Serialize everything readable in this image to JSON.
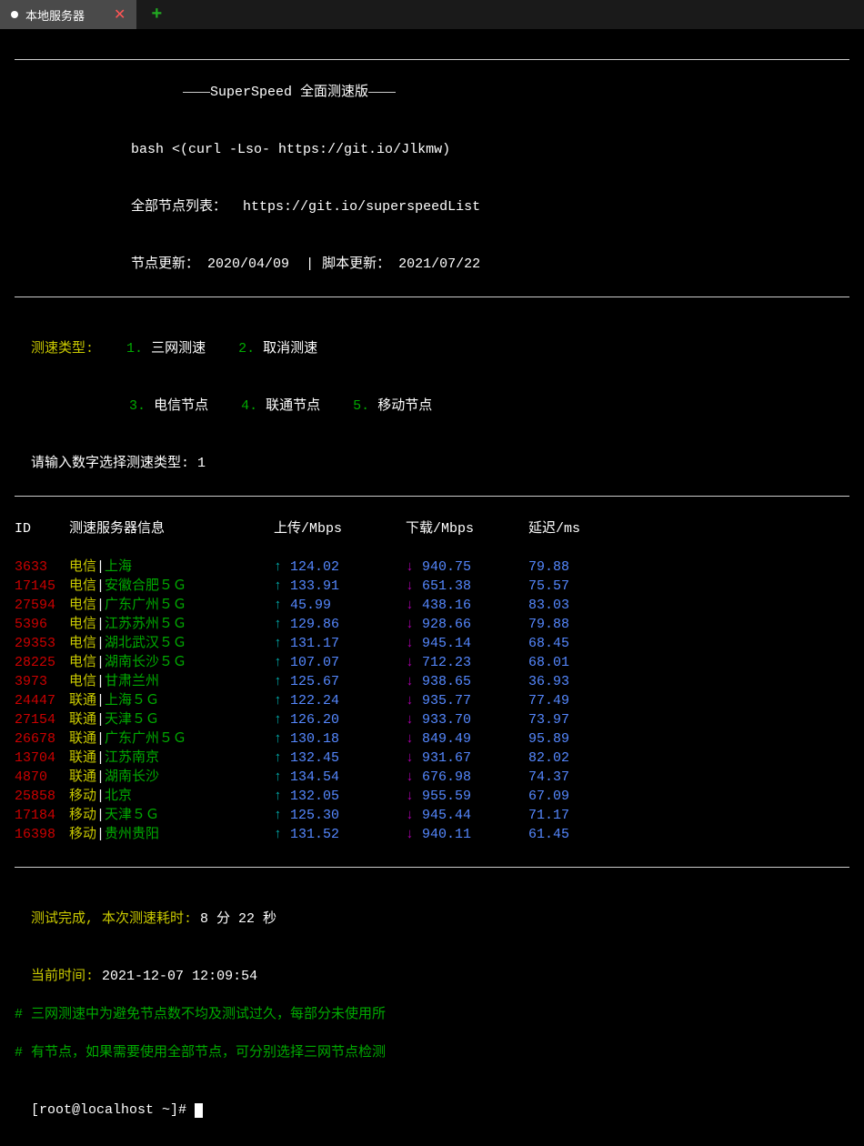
{
  "tab": {
    "title": "本地服务器"
  },
  "header": {
    "title": "SuperSpeed 全面测速版",
    "bash_line": "bash <(curl -Lso- https://git.io/Jlkmw)",
    "node_list_label": "全部节点列表：",
    "node_list_url": "https://git.io/superspeedList",
    "node_update_label": "节点更新：",
    "node_update_date": "2020/04/09",
    "script_update_label": "脚本更新：",
    "script_update_date": "2021/07/22"
  },
  "menu": {
    "label": "测速类型:",
    "opt1_num": "1.",
    "opt1_text": "三网测速",
    "opt2_num": "2.",
    "opt2_text": "取消测速",
    "opt3_num": "3.",
    "opt3_text": "电信节点",
    "opt4_num": "4.",
    "opt4_text": "联通节点",
    "opt5_num": "5.",
    "opt5_text": "移动节点",
    "prompt": "请输入数字选择测速类型: ",
    "input": "1"
  },
  "table": {
    "h_id": "ID",
    "h_info": "测速服务器信息",
    "h_up": "上传/Mbps",
    "h_down": "下载/Mbps",
    "h_ping": "延迟/ms",
    "rows": [
      {
        "id": "3633",
        "isp": "电信",
        "loc": "上海",
        "up": "124.02",
        "down": "940.75",
        "ping": "79.88"
      },
      {
        "id": "17145",
        "isp": "电信",
        "loc": "安徽合肥５Ｇ",
        "up": "133.91",
        "down": "651.38",
        "ping": "75.57"
      },
      {
        "id": "27594",
        "isp": "电信",
        "loc": "广东广州５Ｇ",
        "up": "45.99",
        "down": "438.16",
        "ping": "83.03"
      },
      {
        "id": "5396",
        "isp": "电信",
        "loc": "江苏苏州５Ｇ",
        "up": "129.86",
        "down": "928.66",
        "ping": "79.88"
      },
      {
        "id": "29353",
        "isp": "电信",
        "loc": "湖北武汉５Ｇ",
        "up": "131.17",
        "down": "945.14",
        "ping": "68.45"
      },
      {
        "id": "28225",
        "isp": "电信",
        "loc": "湖南长沙５Ｇ",
        "up": "107.07",
        "down": "712.23",
        "ping": "68.01"
      },
      {
        "id": "3973",
        "isp": "电信",
        "loc": "甘肃兰州",
        "up": "125.67",
        "down": "938.65",
        "ping": "36.93"
      },
      {
        "id": "24447",
        "isp": "联通",
        "loc": "上海５Ｇ",
        "up": "122.24",
        "down": "935.77",
        "ping": "77.49"
      },
      {
        "id": "27154",
        "isp": "联通",
        "loc": "天津５Ｇ",
        "up": "126.20",
        "down": "933.70",
        "ping": "73.97"
      },
      {
        "id": "26678",
        "isp": "联通",
        "loc": "广东广州５Ｇ",
        "up": "130.18",
        "down": "849.49",
        "ping": "95.89"
      },
      {
        "id": "13704",
        "isp": "联通",
        "loc": "江苏南京",
        "up": "132.45",
        "down": "931.67",
        "ping": "82.02"
      },
      {
        "id": "4870",
        "isp": "联通",
        "loc": "湖南长沙",
        "up": "134.54",
        "down": "676.98",
        "ping": "74.37"
      },
      {
        "id": "25858",
        "isp": "移动",
        "loc": "北京",
        "up": "132.05",
        "down": "955.59",
        "ping": "67.09"
      },
      {
        "id": "17184",
        "isp": "移动",
        "loc": "天津５Ｇ",
        "up": "125.30",
        "down": "945.44",
        "ping": "71.17"
      },
      {
        "id": "16398",
        "isp": "移动",
        "loc": "贵州贵阳",
        "up": "131.52",
        "down": "940.11",
        "ping": "61.45"
      }
    ]
  },
  "footer": {
    "complete_label": "测试完成, 本次测速耗时:",
    "duration": "8 分 22 秒",
    "time_label": "当前时间:",
    "time_value": "2021-12-07 12:09:54",
    "note1": "# 三网测速中为避免节点数不均及测试过久，每部分未使用所",
    "note2": "# 有节点，如果需要使用全部节点，可分别选择三网节点检测",
    "prompt": "[root@localhost ~]# "
  }
}
